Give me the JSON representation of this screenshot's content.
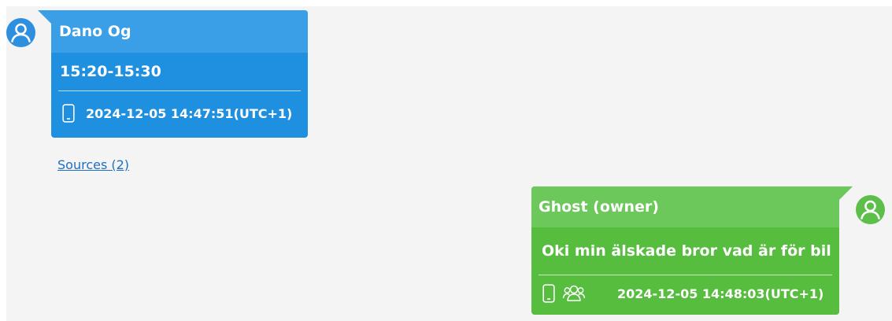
{
  "messages": [
    {
      "direction": "incoming",
      "sender": "Dano Og",
      "text": "15:20-15:30",
      "timestamp": "2024-12-05 14:47:51(UTC+1)",
      "icons": [
        "phone-icon"
      ],
      "color": "#1f8fe0",
      "header_color": "#3a9fe6",
      "avatar_icon": "user-icon",
      "sources_link": "Sources (2)"
    },
    {
      "direction": "outgoing",
      "sender": "Ghost (owner)",
      "text": "Oki min älskade bror vad är för bil",
      "timestamp": "2024-12-05 14:48:03(UTC+1)",
      "icons": [
        "phone-icon",
        "group-icon"
      ],
      "color": "#57bd3f",
      "header_color": "#6dc85b",
      "avatar_icon": "user-icon"
    }
  ]
}
